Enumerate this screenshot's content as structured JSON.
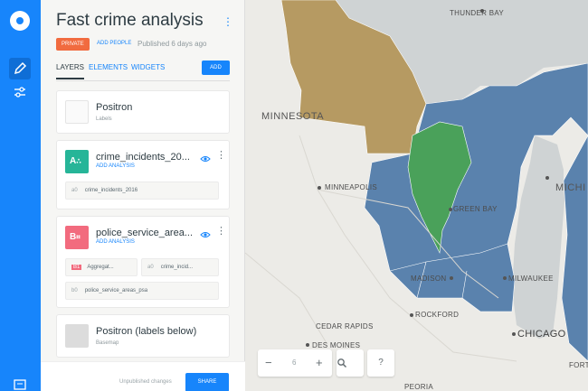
{
  "sidebar": {
    "title": "Fast crime analysis",
    "privacy": "PRIVATE",
    "add_people": "ADD PEOPLE",
    "published": "Published 6 days ago",
    "tabs": [
      {
        "label": "LAYERS"
      },
      {
        "label": "ELEMENTS"
      },
      {
        "label": "WIDGETS"
      }
    ],
    "add_label": "ADD",
    "layers": [
      {
        "name": "Positron",
        "sub": "Labels"
      },
      {
        "name": "crime_incidents_20...",
        "letter": "A",
        "add_analysis": "ADD ANALYSIS",
        "nodes": [
          {
            "code": "a0",
            "label": "crime_incidents_2016"
          }
        ]
      },
      {
        "name": "police_service_area...",
        "letter": "B",
        "add_analysis": "ADD ANALYSIS",
        "nodes": [
          {
            "code": "B1",
            "label": "Aggregat..."
          },
          {
            "code": "a0",
            "label": "crime_incid..."
          },
          {
            "code": "b0",
            "label": "police_service_areas_psa"
          }
        ]
      },
      {
        "name": "Positron (labels below)",
        "sub": "Basemap"
      }
    ],
    "unpublished": "Unpublished changes",
    "share_label": "SHARE"
  },
  "map": {
    "cities": [
      "THUNDER BAY",
      "MINNEAPOLIS",
      "GREEN BAY",
      "MADISON",
      "MILWAUKEE",
      "ROCKFORD",
      "CEDAR RAPIDS",
      "DES MOINES",
      "CHICAGO",
      "FORT WAY",
      "PEORIA"
    ],
    "states": [
      "MINNESOTA",
      "MICHI"
    ],
    "zoom_level": "6",
    "colors": {
      "gold": "#b69a62",
      "blue": "#5a82ad",
      "green": "#4aa15a",
      "water": "#cfd3d4"
    }
  }
}
